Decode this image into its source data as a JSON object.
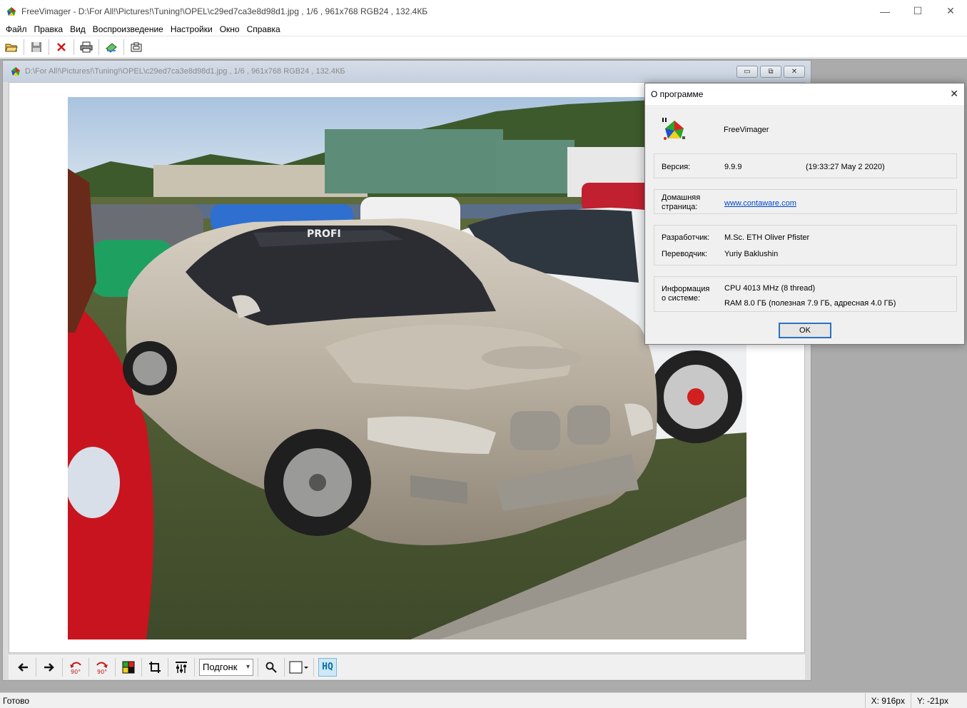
{
  "window": {
    "title": "FreeVimager - D:\\For All!\\Pictures!\\Tuning!\\OPEL\\c29ed7ca3e8d98d1.jpg , 1/6 , 961x768 RGB24 , 132.4КБ",
    "minimize": "—",
    "maximize": "☐",
    "close": "✕"
  },
  "menu": {
    "items": [
      "Файл",
      "Правка",
      "Вид",
      "Воспроизведение",
      "Настройки",
      "Окно",
      "Справка"
    ]
  },
  "toolbar": {
    "buttons": [
      "open-icon",
      "save-icon",
      "delete-icon",
      "print-icon",
      "scan-icon",
      "capture-icon"
    ]
  },
  "child": {
    "title": "D:\\For All!\\Pictures!\\Tuning!\\OPEL\\c29ed7ca3e8d98d1.jpg , 1/6 , 961x768 RGB24 , 132.4КБ"
  },
  "viewer_toolbar": {
    "fit_mode": "Подгонк",
    "hq": "HQ",
    "rotate_label": "90°"
  },
  "statusbar": {
    "status": "Готово",
    "x": "X: 916px",
    "y": "Y: -21px"
  },
  "about": {
    "title": "О программе",
    "app_name": "FreeVimager",
    "version_label": "Версия:",
    "version_value": "9.9.9",
    "build_date": "(19:33:27  May  2 2020)",
    "homepage_label_1": "Домашняя",
    "homepage_label_2": "страница:",
    "homepage_url": "www.contaware.com",
    "developer_label": "Разработчик:",
    "developer_value": "M.Sc. ETH Oliver Pfister",
    "translator_label": "Переводчик:",
    "translator_value": "Yuriy Baklushin",
    "sysinfo_label_1": "Информация",
    "sysinfo_label_2": "о системе:",
    "cpu": "CPU  4013 MHz (8 thread)",
    "ram": "RAM  8.0 ГБ (полезная 7.9 ГБ, адресная 4.0 ГБ)",
    "ok": "OK"
  }
}
